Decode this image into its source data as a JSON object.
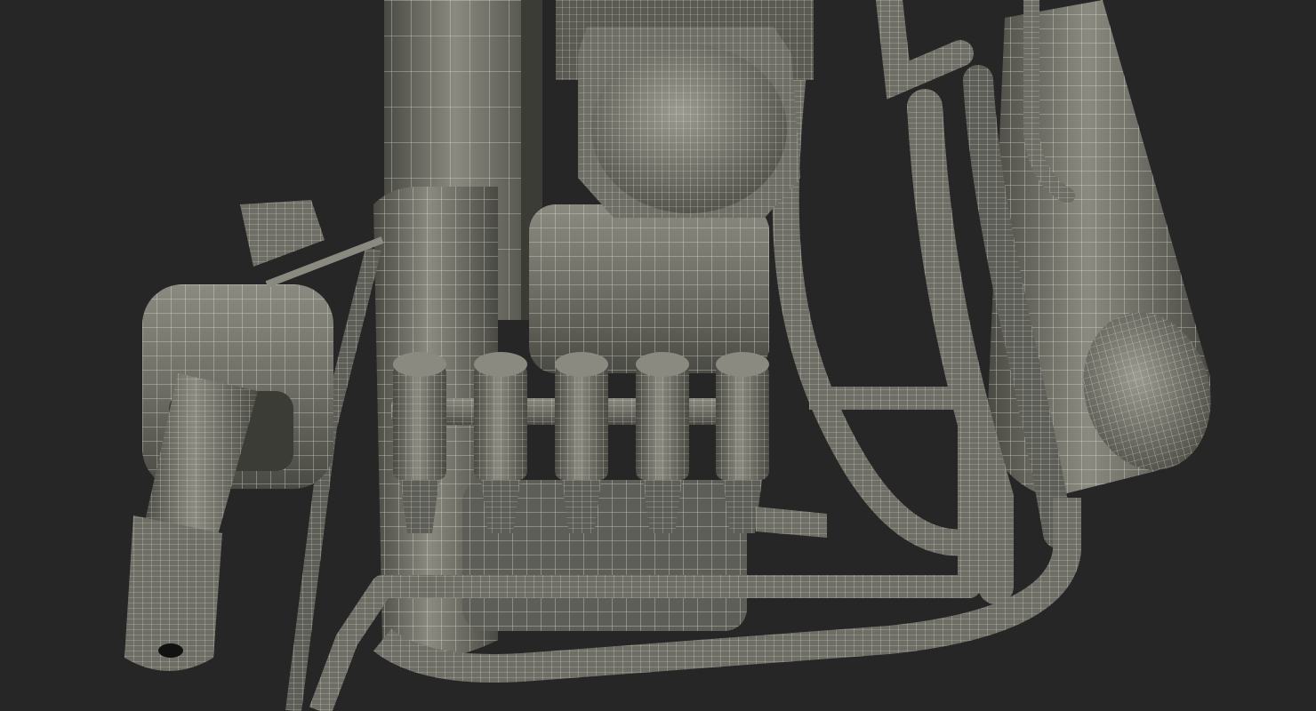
{
  "scene": {
    "subject": "wireframe-3d-render",
    "components": [
      "fuel-injector-1",
      "fuel-injector-2",
      "fuel-injector-3",
      "fuel-injector-4",
      "fuel-injector-5",
      "fuel-rail",
      "throttle-body",
      "side-nozzle",
      "upper-box",
      "reservoir-tank",
      "rounded-housing",
      "large-tank",
      "main-pipe",
      "lower-pipe",
      "diagonal-hose",
      "vertical-hoses"
    ]
  },
  "colors": {
    "background": "#262626",
    "surface": "#6e6e66",
    "surface_light": "#8a8a80",
    "surface_dark": "#4a4a44",
    "wire": "#e8e8dc",
    "wire_soft": "#cfcfc2"
  }
}
